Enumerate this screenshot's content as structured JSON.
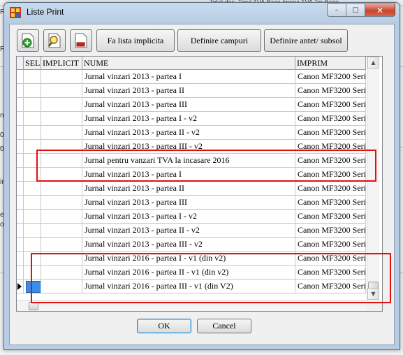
{
  "background": {
    "top_text": "Total doc. Tipul  TVA  Baza Impoz  TVA  Tip  Baza",
    "left_fragments": [
      "R",
      "R",
      "nt",
      "0",
      "0",
      "in",
      "ef",
      "old",
      "p",
      "ti"
    ]
  },
  "window": {
    "title": "Liste Print",
    "app_icon": "grid-app-icon",
    "controls": {
      "minimize": "–",
      "maximize": "□",
      "close": "✕"
    }
  },
  "toolbar": {
    "icons": [
      "add-list-icon",
      "search-list-icon",
      "delete-list-icon"
    ],
    "implicit_label": "Fa lista implicita",
    "fields_label": "Definire campuri",
    "header_footer_label": "Definire antet/ subsol"
  },
  "grid": {
    "columns": [
      "SEL",
      "IMPLICIT",
      "NUME",
      "IMPRIM"
    ],
    "rows": [
      {
        "nume": "Jurnal vinzari  2013 - partea I",
        "imprim": "Canon MF3200 Series"
      },
      {
        "nume": "Jurnal vinzari  2013 - partea II",
        "imprim": "Canon MF3200 Series"
      },
      {
        "nume": "Jurnal vinzari  2013 - partea III",
        "imprim": "Canon MF3200 Series"
      },
      {
        "nume": "Jurnal vinzari  2013 - partea I - v2",
        "imprim": "Canon MF3200 Series"
      },
      {
        "nume": "Jurnal vinzari  2013 - partea II - v2",
        "imprim": "Canon MF3200 Series"
      },
      {
        "nume": "Jurnal vinzari  2013 - partea III - v2",
        "imprim": "Canon MF3200 Series"
      },
      {
        "nume": "Jurnal pentru vanzari TVA la incasare 2016",
        "imprim": "Canon MF3200 Series"
      },
      {
        "nume": "Jurnal vinzari  2013 - partea I",
        "imprim": "Canon MF3200 Series"
      },
      {
        "nume": "Jurnal vinzari  2013 - partea II",
        "imprim": "Canon MF3200 Series"
      },
      {
        "nume": "Jurnal vinzari  2013 - partea III",
        "imprim": "Canon MF3200 Series"
      },
      {
        "nume": "Jurnal vinzari  2013 - partea I - v2",
        "imprim": "Canon MF3200 Series"
      },
      {
        "nume": "Jurnal vinzari  2013 - partea II - v2",
        "imprim": "Canon MF3200 Series"
      },
      {
        "nume": "Jurnal vinzari  2013 - partea III - v2",
        "imprim": "Canon MF3200 Series"
      },
      {
        "nume": "Jurnal vinzari  2016 - partea I - v1 (din v2)",
        "imprim": "Canon MF3200 Series"
      },
      {
        "nume": "Jurnal vinzari  2016 - partea II - v1 (din v2)",
        "imprim": "Canon MF3200 Series"
      },
      {
        "nume": "Jurnal vinzari  2016 - partea III - v1 (din V2)",
        "imprim": "Canon MF3200 Series"
      }
    ],
    "current_row_index": 15,
    "selected_row_index": 15
  },
  "buttons": {
    "ok": "OK",
    "cancel": "Cancel"
  },
  "colors": {
    "highlight": "#e01010",
    "selection": "#3b8ee8"
  }
}
